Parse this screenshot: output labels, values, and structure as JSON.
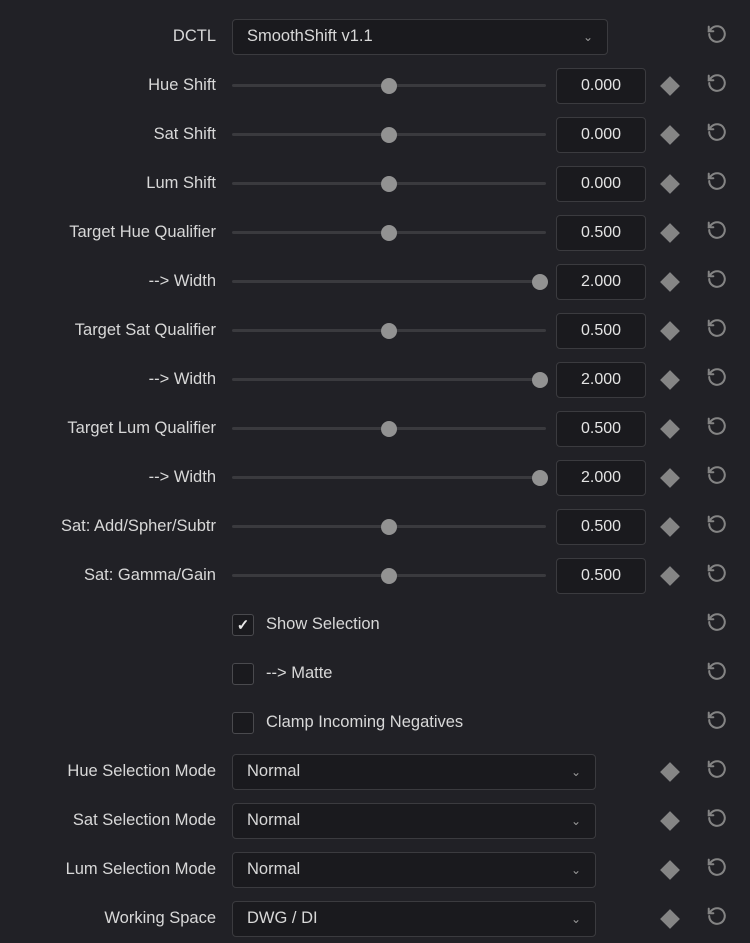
{
  "header": {
    "label": "DCTL",
    "dropdown_value": "SmoothShift v1.1"
  },
  "sliders": [
    {
      "label": "Hue Shift",
      "value": "0.000",
      "pos": 50
    },
    {
      "label": "Sat Shift",
      "value": "0.000",
      "pos": 50
    },
    {
      "label": "Lum Shift",
      "value": "0.000",
      "pos": 50
    },
    {
      "label": "Target Hue Qualifier",
      "value": "0.500",
      "pos": 50
    },
    {
      "label": "--> Width",
      "value": "2.000",
      "pos": 98
    },
    {
      "label": "Target Sat Qualifier",
      "value": "0.500",
      "pos": 50
    },
    {
      "label": "--> Width",
      "value": "2.000",
      "pos": 98
    },
    {
      "label": "Target Lum Qualifier",
      "value": "0.500",
      "pos": 50
    },
    {
      "label": "--> Width",
      "value": "2.000",
      "pos": 98
    },
    {
      "label": "Sat: Add/Spher/Subtr",
      "value": "0.500",
      "pos": 50
    },
    {
      "label": "Sat: Gamma/Gain",
      "value": "0.500",
      "pos": 50
    }
  ],
  "checkboxes": [
    {
      "label": "Show Selection",
      "checked": true
    },
    {
      "label": "--> Matte",
      "checked": false
    },
    {
      "label": "Clamp Incoming Negatives",
      "checked": false
    }
  ],
  "dropdowns": [
    {
      "label": "Hue Selection Mode",
      "value": "Normal"
    },
    {
      "label": "Sat Selection Mode",
      "value": "Normal"
    },
    {
      "label": "Lum Selection Mode",
      "value": "Normal"
    },
    {
      "label": "Working Space",
      "value": "DWG / DI"
    }
  ]
}
